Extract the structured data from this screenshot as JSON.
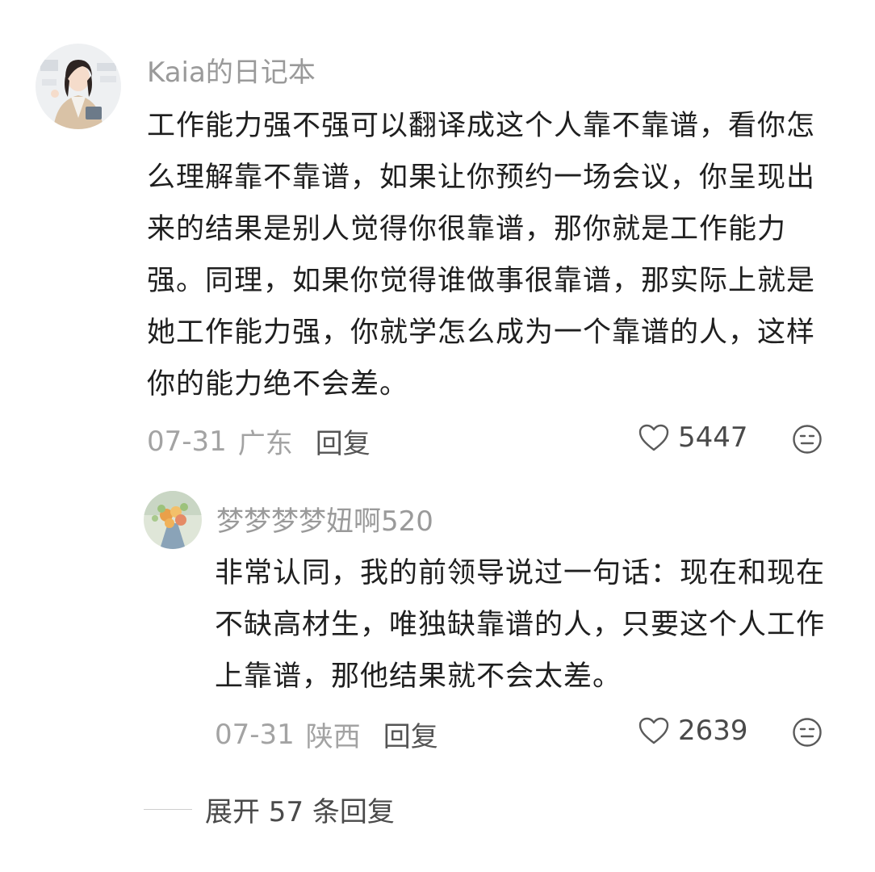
{
  "comments": [
    {
      "username": "Kaia的日记本",
      "text": "工作能力强不强可以翻译成这个人靠不靠谱，看你怎么理解靠不靠谱，如果让你预约一场会议，你呈现出来的结果是别人觉得你很靠谱，那你就是工作能力强。同理，如果你觉得谁做事很靠谱，那实际上就是她工作能力强，你就学怎么成为一个靠谱的人，这样你的能力绝不会差。",
      "date": "07-31",
      "region": "广东",
      "reply_label": "回复",
      "likes": "5447",
      "avatar_icon": "user-avatar-photo"
    },
    {
      "username": "梦梦梦梦妞啊520",
      "text": "非常认同，我的前领导说过一句话：现在和现在不缺高材生，唯独缺靠谱的人，只要这个人工作上靠谱，那他结果就不会太差。",
      "date": "07-31",
      "region": "陕西",
      "reply_label": "回复",
      "likes": "2639",
      "avatar_icon": "flower-bouquet-avatar"
    }
  ],
  "expand_replies": "展开 57 条回复",
  "icons": {
    "like": "heart-outline-icon",
    "dislike": "neutral-face-icon"
  },
  "colors": {
    "username": "#9a9a9a",
    "text": "#1f1f1f",
    "meta": "#a3a3a3"
  }
}
